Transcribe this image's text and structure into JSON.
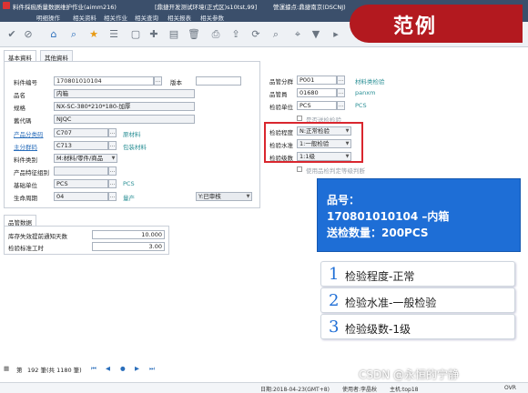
{
  "window": {
    "title": "料件採痂质量数据维护作业(aimm216)",
    "env": "[鼎捷开发测试环境(正式区)s10tst,99]",
    "company": "營運據点:鼎捷南京(DSCNJ)"
  },
  "menu": [
    "明细操作",
    "相关资料",
    "相关作业",
    "相关查询",
    "相关报表",
    "相关参数"
  ],
  "toolbar_icons": [
    "check-icon",
    "cancel-icon",
    "home-icon",
    "search-icon",
    "favorite-icon",
    "menu-icon",
    "new-icon",
    "add-icon",
    "delete-icon",
    "trash-icon",
    "print-icon",
    "export-icon",
    "refresh-icon",
    "filter-icon",
    "funnel-icon",
    "more-icon"
  ],
  "tabs": [
    "基本資料",
    "其他資料"
  ],
  "form": {
    "item_no_label": "料件编号",
    "item_no": "170801010104",
    "version_label": "版本",
    "version": "",
    "name_label": "品名",
    "name": "内箱",
    "spec_label": "规格",
    "spec": "NX-SC-380*210*180-加厚",
    "old_no_label": "舊代碼",
    "old_no": "NJQC",
    "product_cat_label": "产品分类码",
    "product_cat": "C707",
    "product_cat_desc": "原材料",
    "main_cat_label": "主分群码",
    "main_cat": "C713",
    "main_cat_desc": "包装材料",
    "item_type_label": "料件类别",
    "item_type": "M:材料/零件/商品",
    "product_group_label": "产品特征组别",
    "product_group": "",
    "base_unit_label": "基础单位",
    "base_unit": "PCS",
    "base_unit_desc": "PCS",
    "life_cycle_label": "生命周期",
    "life_cycle": "04",
    "life_cycle_desc": "量产",
    "status": "Y:已审核"
  },
  "right_form": {
    "supplier_cat_label": "品管分群",
    "supplier_cat": "P001",
    "supplier_cat_desc": "材料类检验",
    "inspector_label": "品管員",
    "inspector": "01680",
    "inspector_desc": "panxm",
    "insp_unit_label": "检验单位",
    "insp_unit": "PCS",
    "insp_unit_desc": "PCS",
    "checkbox1": "是否送检检验",
    "insp_degree_label": "检验程度",
    "insp_degree": "N:正常检验",
    "insp_level_label": "检验水准",
    "insp_level": "1:一般检验",
    "insp_grade_label": "检验级数",
    "insp_grade": "1:1级",
    "checkbox2": "使用品检判定等级判断"
  },
  "quality_tab": "品管数据",
  "quality": {
    "invalid_days_label": "库存失效提前通知天数",
    "invalid_days": "10.000",
    "std_hours_label": "检验标准工时",
    "std_hours": "3.00"
  },
  "banner": "范例",
  "callout": {
    "line1": "品号：",
    "line2": "170801010104 –内箱",
    "line3": "送检数量：200PCS"
  },
  "steps": [
    {
      "num": "1",
      "text": "检验程度-正常"
    },
    {
      "num": "2",
      "text": "检验水准-一般检验"
    },
    {
      "num": "3",
      "text": "检验级数-1级"
    }
  ],
  "pager": {
    "label": "第",
    "count": "192 筆(共 1180 筆)"
  },
  "status": {
    "date": "日期:2018-04-23(GMT+8)",
    "user": "使用者:李晶秋",
    "host": "主机:top18",
    "ovr": "OVR"
  },
  "watermark": "CSDN @永恒的宁静"
}
